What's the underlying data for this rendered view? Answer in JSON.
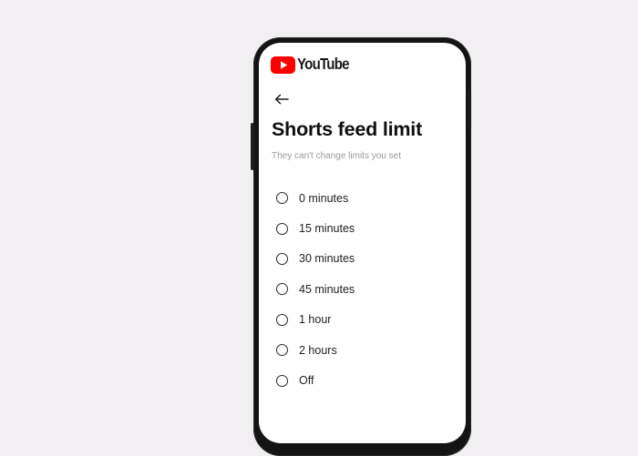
{
  "app": {
    "brand_name": "YouTube",
    "brand_color": "#ff0000"
  },
  "background_color": "#f1eff1",
  "header": {
    "back_icon": "arrow-left-icon"
  },
  "page": {
    "title": "Shorts feed limit",
    "subtitle": "They can't change limits you set"
  },
  "options": [
    {
      "label": "0 minutes",
      "selected": false
    },
    {
      "label": "15 minutes",
      "selected": false
    },
    {
      "label": "30 minutes",
      "selected": false
    },
    {
      "label": "45 minutes",
      "selected": false
    },
    {
      "label": "1 hour",
      "selected": false
    },
    {
      "label": "2 hours",
      "selected": false
    },
    {
      "label": "Off",
      "selected": false
    }
  ]
}
